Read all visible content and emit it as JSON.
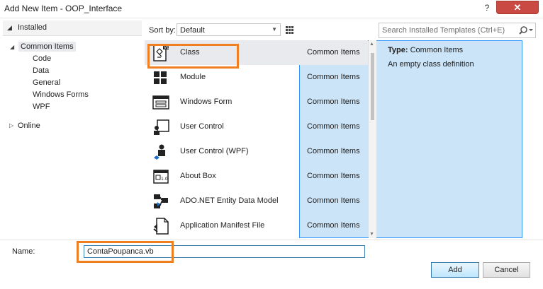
{
  "window": {
    "title": "Add New Item - OOP_Interface",
    "help_label": "?",
    "close_label": "✕"
  },
  "tree": {
    "header": "Installed",
    "items": [
      {
        "label": "Common Items",
        "level": 1,
        "expanded": true,
        "selected": true
      },
      {
        "label": "Code",
        "level": 2
      },
      {
        "label": "Data",
        "level": 2
      },
      {
        "label": "General",
        "level": 2
      },
      {
        "label": "Windows Forms",
        "level": 2
      },
      {
        "label": "WPF",
        "level": 2
      },
      {
        "label": "Online",
        "level": 1,
        "expanded": false
      }
    ]
  },
  "sort": {
    "label": "Sort by:",
    "value": "Default"
  },
  "templates": [
    {
      "name": "Class",
      "category": "Common Items",
      "icon": "class-icon",
      "selected": true
    },
    {
      "name": "Module",
      "category": "Common Items",
      "icon": "module-icon"
    },
    {
      "name": "Windows Form",
      "category": "Common Items",
      "icon": "windows-form-icon"
    },
    {
      "name": "User Control",
      "category": "Common Items",
      "icon": "user-control-icon"
    },
    {
      "name": "User Control (WPF)",
      "category": "Common Items",
      "icon": "user-control-wpf-icon"
    },
    {
      "name": "About Box",
      "category": "Common Items",
      "icon": "about-box-icon"
    },
    {
      "name": "ADO.NET Entity Data Model",
      "category": "Common Items",
      "icon": "entity-data-model-icon"
    },
    {
      "name": "Application Manifest File",
      "category": "Common Items",
      "icon": "manifest-file-icon"
    }
  ],
  "search": {
    "placeholder": "Search Installed Templates (Ctrl+E)"
  },
  "details": {
    "type_label": "Type:",
    "type_value": "Common Items",
    "description": "An empty class definition"
  },
  "name_field": {
    "label": "Name:",
    "value": "ContaPoupanca.vb"
  },
  "buttons": {
    "add": "Add",
    "cancel": "Cancel"
  },
  "colors": {
    "highlight": "#f07f22",
    "selection": "#e8eaee",
    "close_button": "#c94a42",
    "focus_border": "#3c7fb1"
  }
}
